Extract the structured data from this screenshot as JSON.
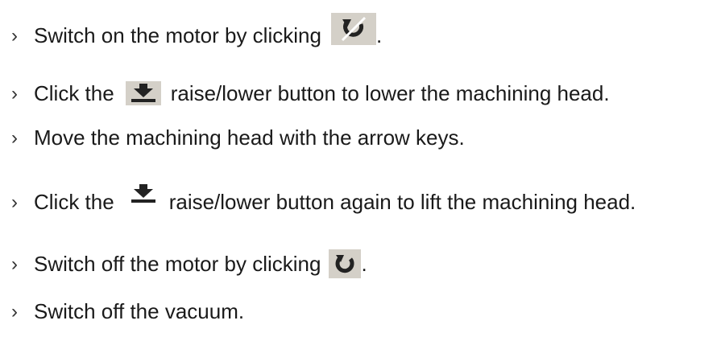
{
  "bullet": "›",
  "steps": [
    {
      "text_before": "Switch on the motor by clicking",
      "icon": "motor-on-icon",
      "text_after": "."
    },
    {
      "text_before": "Click the",
      "icon": "lower-arrow-icon",
      "text_after": "raise/lower button to lower the machining head."
    },
    {
      "text_before": "Move the machining head with the arrow keys."
    },
    {
      "text_before": "Click the",
      "icon": "lower-arrow-icon",
      "text_after": "raise/lower button again to lift the machining head."
    },
    {
      "text_before": "Switch off the motor by clicking",
      "icon": "motor-off-icon",
      "text_after": "."
    },
    {
      "text_before": "Switch off the vacuum."
    }
  ],
  "colors": {
    "text": "#1a1a1a",
    "icon_bg": "#d4d0c8",
    "icon_dark": "#222222"
  }
}
